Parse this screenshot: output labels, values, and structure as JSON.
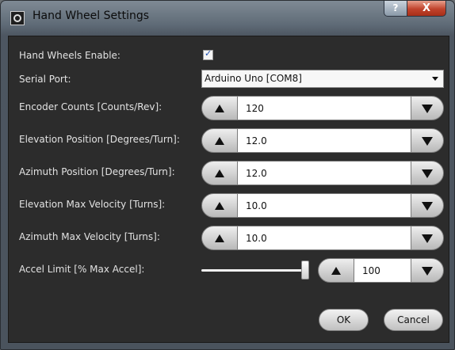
{
  "window": {
    "title": "Hand Wheel Settings"
  },
  "caption": {
    "help": "?",
    "close": "X"
  },
  "form": {
    "hand_wheels_enable": {
      "label": "Hand Wheels Enable:",
      "checked": true,
      "check_glyph": "✓"
    },
    "serial_port": {
      "label": "Serial Port:",
      "value": "Arduino Uno [COM8]"
    },
    "encoder_counts": {
      "label": "Encoder Counts [Counts/Rev]:",
      "value": "120"
    },
    "elevation_position": {
      "label": "Elevation Position [Degrees/Turn]:",
      "value": "12.0"
    },
    "azimuth_position": {
      "label": "Azimuth Position [Degrees/Turn]:",
      "value": "12.0"
    },
    "elevation_max_velocity": {
      "label": "Elevation Max Velocity [Turns]:",
      "value": "10.0"
    },
    "azimuth_max_velocity": {
      "label": "Azimuth Max Velocity [Turns]:",
      "value": "10.0"
    },
    "accel_limit": {
      "label": "Accel Limit [% Max Accel]:",
      "value": "100",
      "slider_fraction": 0.95
    }
  },
  "buttons": {
    "ok": "OK",
    "cancel": "Cancel"
  },
  "icons": {
    "app": "hand-wheel-app-icon",
    "up": "up-arrow-icon",
    "down": "down-arrow-icon"
  },
  "colors": {
    "background": "#2c2c2c",
    "label_text": "#e2e2e2",
    "close_button": "#c0432c"
  }
}
